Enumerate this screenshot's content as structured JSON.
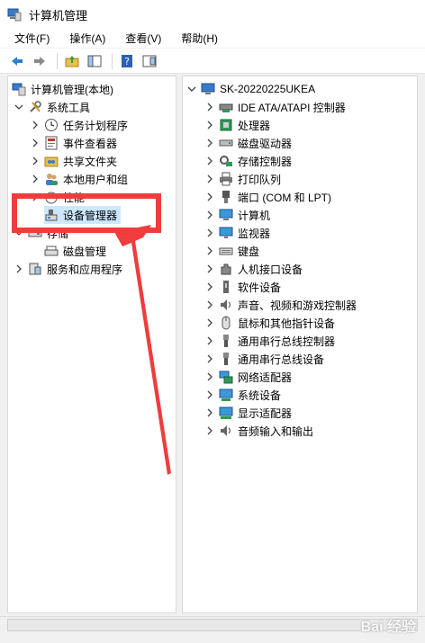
{
  "window": {
    "title": "计算机管理"
  },
  "menu": [
    "文件(F)",
    "操作(A)",
    "查看(V)",
    "帮助(H)"
  ],
  "toolbar": {
    "buttons": [
      "back-arrow-icon",
      "forward-arrow-icon",
      "up-folder-icon",
      "show-tree-icon",
      "help-icon",
      "properties-icon"
    ]
  },
  "left_tree": {
    "root": "计算机管理(本地)",
    "system_tools": "系统工具",
    "task_scheduler": "任务计划程序",
    "event_viewer": "事件查看器",
    "shared_folders": "共享文件夹",
    "local_users": "本地用户和组",
    "performance": "性能",
    "device_manager": "设备管理器",
    "storage": "存储",
    "disk_management": "磁盘管理",
    "services_apps": "服务和应用程序"
  },
  "right_tree": {
    "computer_name": "SK-20220225UKEA",
    "categories": [
      "IDE ATA/ATAPI 控制器",
      "处理器",
      "磁盘驱动器",
      "存储控制器",
      "打印队列",
      "端口 (COM 和 LPT)",
      "计算机",
      "监视器",
      "键盘",
      "人机接口设备",
      "软件设备",
      "声音、视频和游戏控制器",
      "鼠标和其他指针设备",
      "通用串行总线控制器",
      "通用串行总线设备",
      "网络适配器",
      "系统设备",
      "显示适配器",
      "音频输入和输出"
    ]
  },
  "watermark": "Bai 经验",
  "colors": {
    "annotation_red": "#f03c3c",
    "selection_blue": "#cce8ff"
  }
}
